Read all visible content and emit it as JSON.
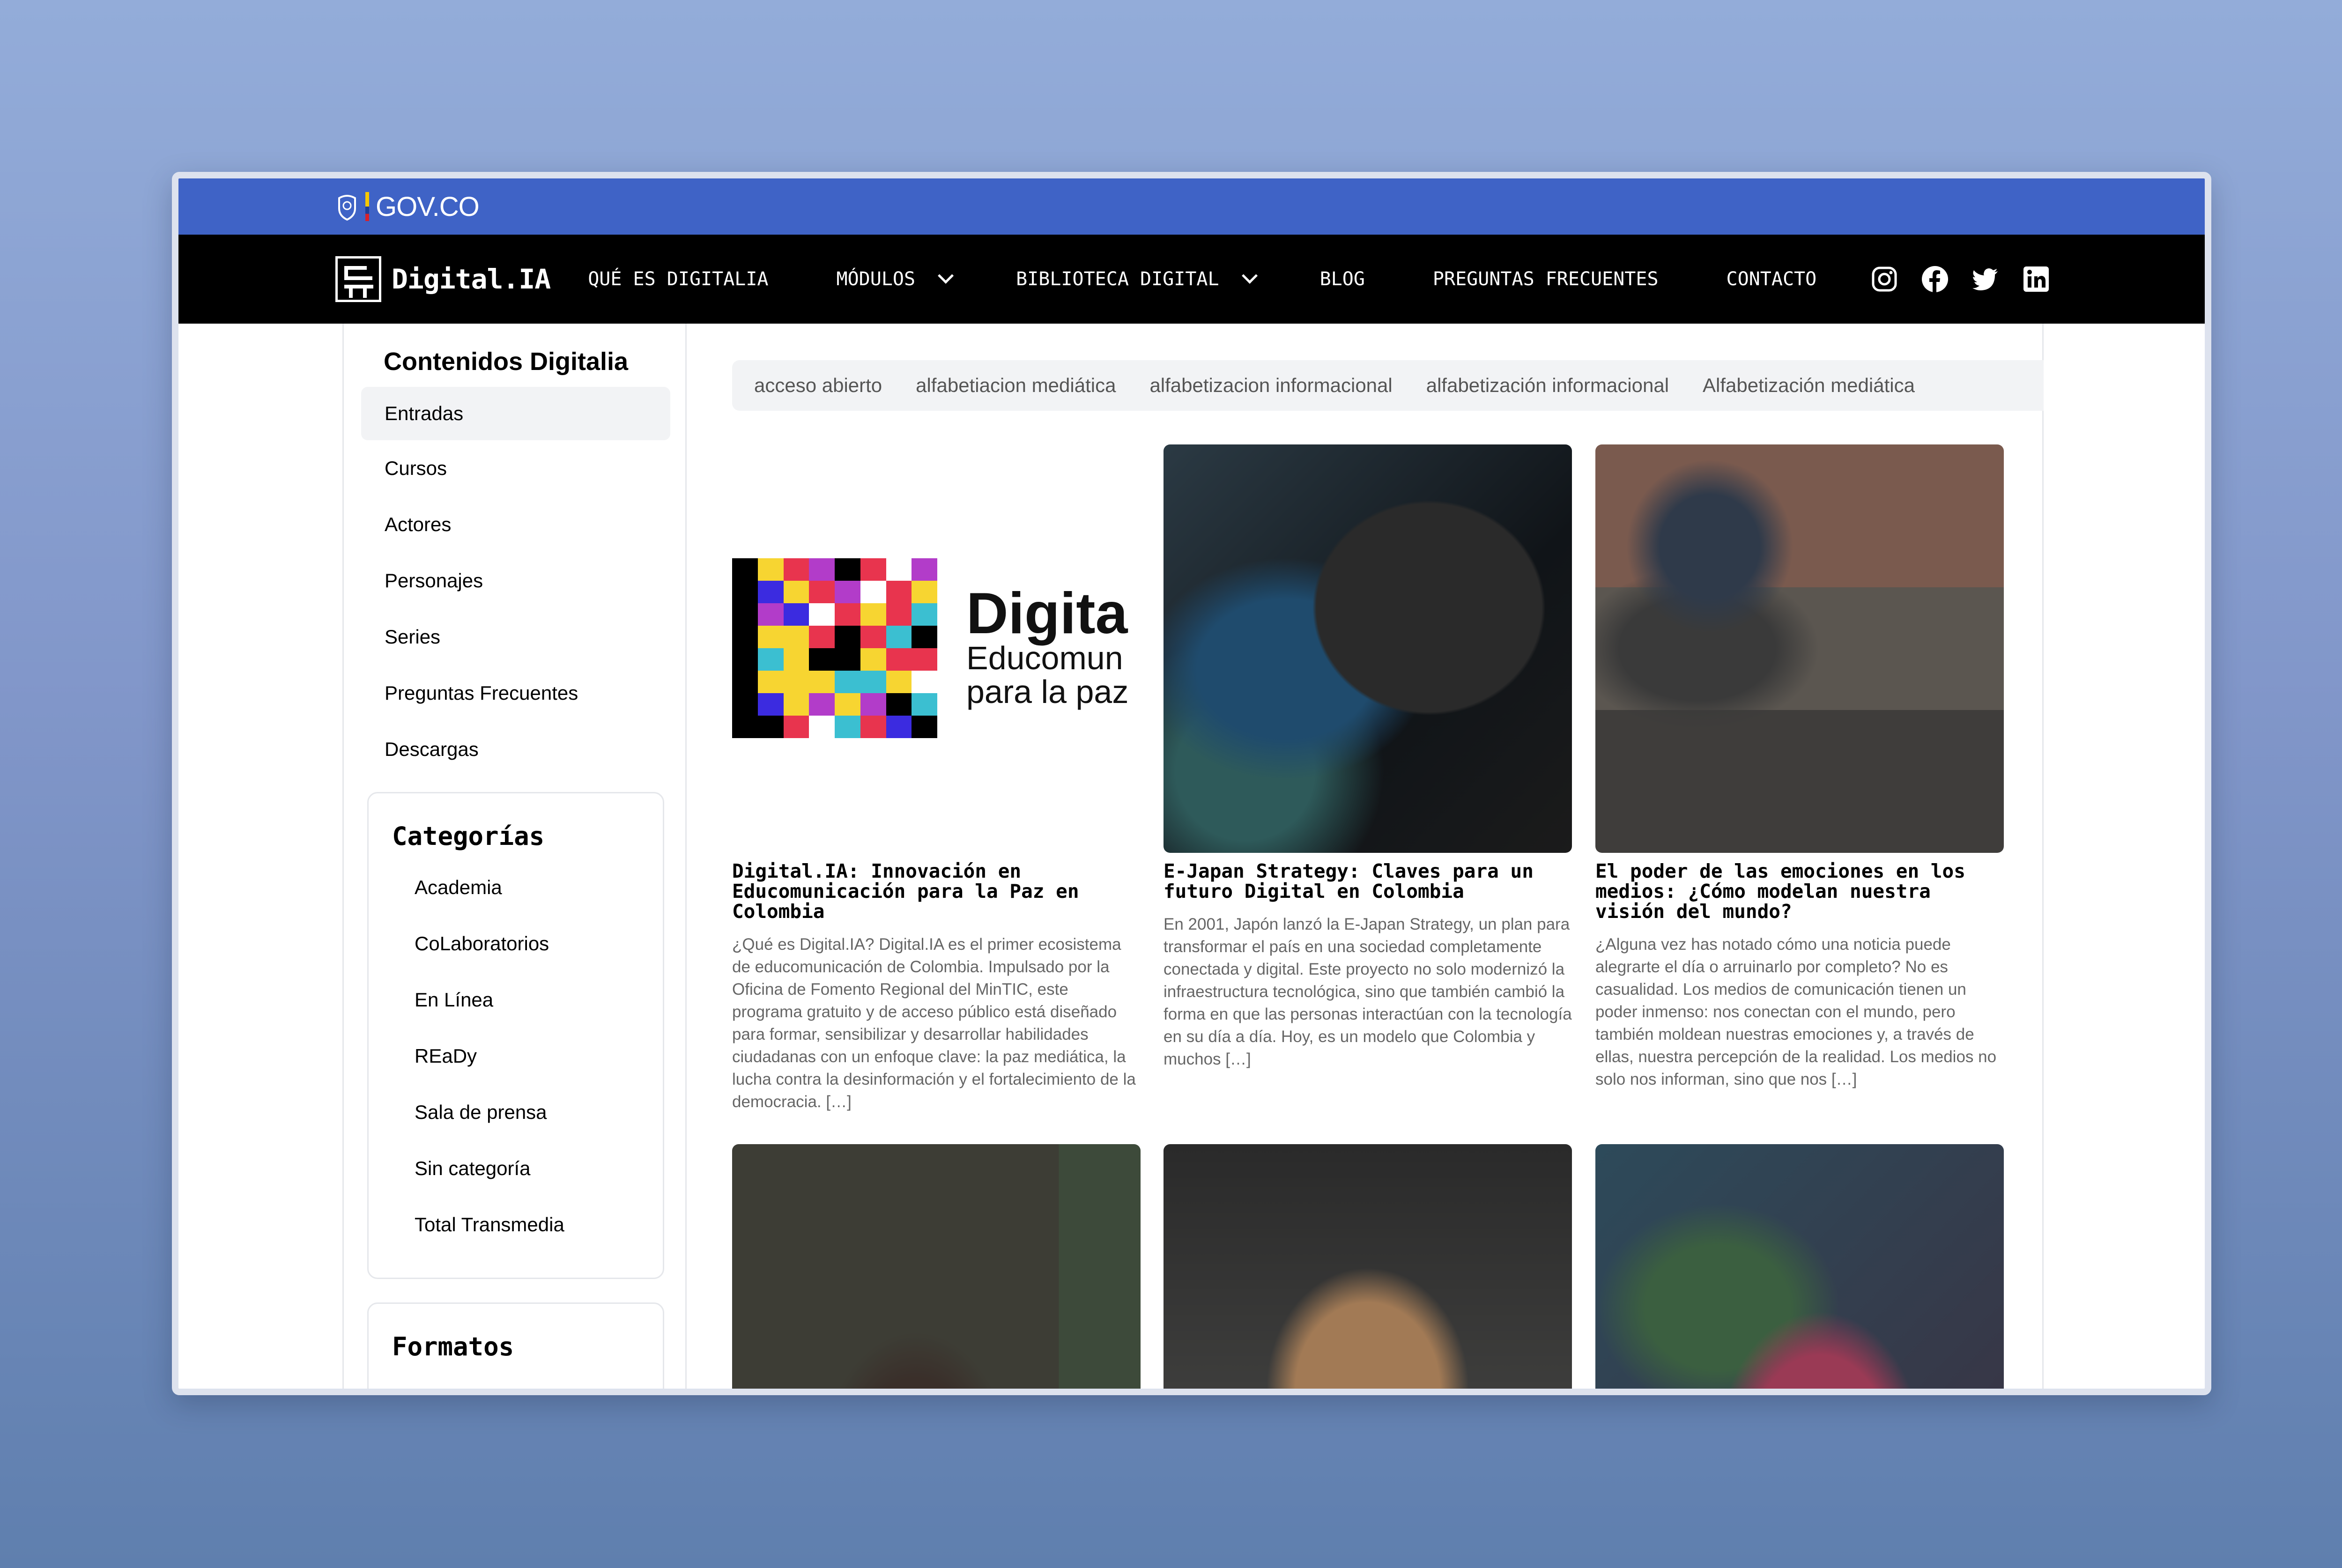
{
  "gov_bar": {
    "label": "GOV.CO"
  },
  "navbar": {
    "brand": "Digital.IA",
    "items": [
      {
        "label": "QUÉ ES DIGITALIA",
        "has_dropdown": false
      },
      {
        "label": "MÓDULOS",
        "has_dropdown": true
      },
      {
        "label": "BIBLIOTECA DIGITAL",
        "has_dropdown": true
      },
      {
        "label": "BLOG",
        "has_dropdown": false
      },
      {
        "label": "PREGUNTAS FRECUENTES",
        "has_dropdown": false
      },
      {
        "label": "CONTACTO",
        "has_dropdown": false
      }
    ],
    "socials": [
      "instagram-icon",
      "facebook-icon",
      "twitter-icon",
      "linkedin-icon"
    ]
  },
  "sidebar": {
    "title": "Contenidos Digitalia",
    "items": [
      {
        "label": "Entradas",
        "active": true
      },
      {
        "label": "Cursos"
      },
      {
        "label": "Actores"
      },
      {
        "label": "Personajes"
      },
      {
        "label": "Series"
      },
      {
        "label": "Preguntas Frecuentes"
      },
      {
        "label": "Descargas"
      }
    ],
    "categories": {
      "title": "Categorías",
      "items": [
        "Academia",
        "CoLaboratorios",
        "En Línea",
        "REaDy",
        "Sala de prensa",
        "Sin categoría",
        "Total Transmedia"
      ]
    },
    "formats": {
      "title": "Formatos"
    }
  },
  "tags": [
    "acceso abierto",
    "alfabetiacion mediática",
    "alfabetizacion informacional",
    "alfabetización informacional",
    "Alfabetización mediática"
  ],
  "posts": [
    {
      "title": "Digital.IA: Innovación en Educomunicación para la Paz en Colombia",
      "excerpt": "¿Qué es Digital.IA?  Digital.IA es el primer ecosistema de educomunicación de Colombia. Impulsado por la Oficina de Fomento Regional del MinTIC, este programa gratuito y de acceso público está diseñado para formar, sensibilizar y desarrollar habilidades ciudadanas con un enfoque clave: la paz mediática, la lucha contra la desinformación y el fortalecimiento de la democracia. […]",
      "thumb_text": {
        "word": "Digita",
        "line1": "Educomun",
        "line2": "para la paz"
      }
    },
    {
      "title": "E-Japan Strategy: Claves para un futuro Digital en Colombia",
      "excerpt": "En 2001, Japón lanzó la E-Japan Strategy, un plan para transformar el país en una sociedad completamente conectada y digital. Este proyecto no solo modernizó la infraestructura tecnológica, sino que también cambió la forma en que las personas interactúan con la tecnología en su día a día. Hoy, es un modelo que Colombia y muchos […]"
    },
    {
      "title": "El poder de las emociones en los medios: ¿Cómo modelan nuestra visión del mundo?",
      "excerpt": "¿Alguna vez has notado cómo una noticia puede alegrarte el día o arruinarlo por completo? No es casualidad. Los medios de comunicación tienen un poder inmenso: nos conectan con el mundo, pero también moldean nuestras emociones y, a través de ellas, nuestra percepción de la realidad. Los medios no solo nos informan, sino que nos […]"
    }
  ],
  "colors": {
    "gov_blue": "#3f63c6",
    "nav_bg": "#000000",
    "tag_bg": "#f2f3f5",
    "logo_palette": [
      "#e8344e",
      "#f7d531",
      "#3b2be0",
      "#b23cc9",
      "#3bbfd1",
      "#000000",
      "#ffffff"
    ]
  }
}
